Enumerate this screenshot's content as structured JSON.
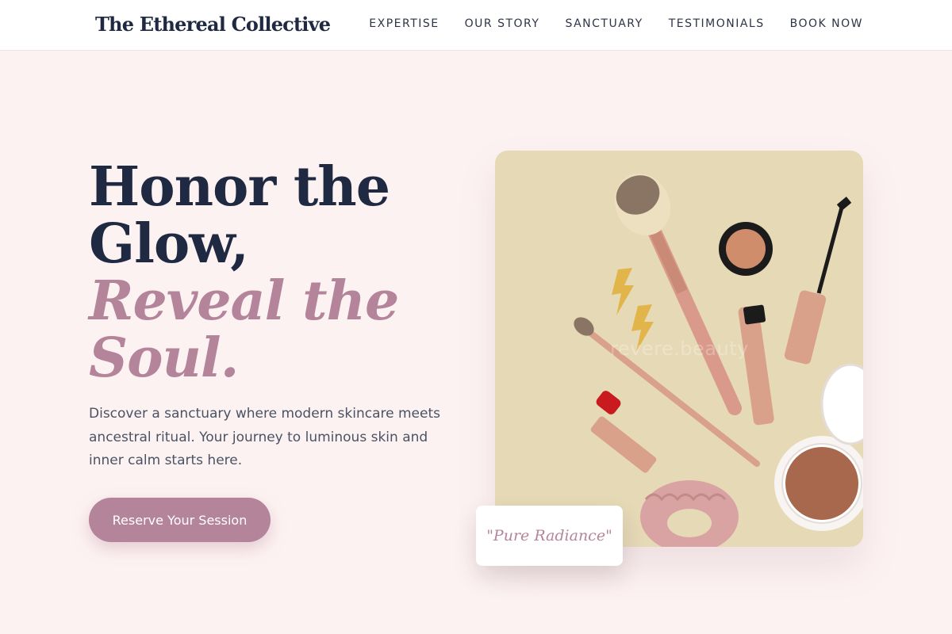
{
  "nav": {
    "brand": "The Ethereal Collective",
    "links": [
      "EXPERTISE",
      "OUR STORY",
      "SANCTUARY",
      "TESTIMONIALS",
      "BOOK NOW"
    ]
  },
  "hero": {
    "title_line1": "Honor the",
    "title_line2": "Glow,",
    "title_accent1": "Reveal the",
    "title_accent2": "Soul.",
    "description": "Discover a sanctuary where modern skincare meets ancestral ritual. Your journey to luminous skin and inner calm starts here.",
    "cta_label": "Reserve Your Session"
  },
  "image": {
    "watermark": "revere.beauty",
    "quote": "\"Pure Radiance\""
  },
  "colors": {
    "background": "#fdf2f2",
    "accent": "#b4849a",
    "heading": "#1f2942",
    "image_bg": "#e6d9b6"
  },
  "icons": [
    "makeup-flatlay-image"
  ]
}
